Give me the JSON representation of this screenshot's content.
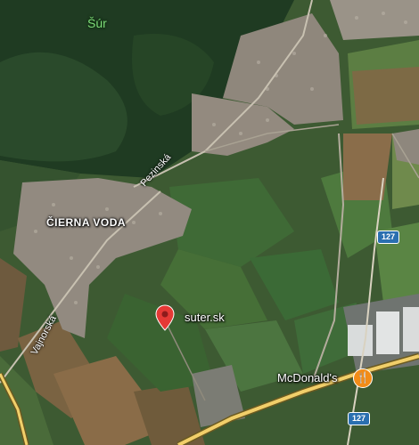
{
  "map": {
    "places": {
      "forest": "Šúr",
      "village": "ČIERNA VODA"
    },
    "roads": {
      "pezinska": "Pezinská",
      "vajnorska": "Vajnorská"
    },
    "shields": {
      "top": "127",
      "bottom": "127"
    },
    "pois": {
      "suter": {
        "label": "suter.sk",
        "icon": "red-map-pin-icon"
      },
      "mcdonalds": {
        "label": "McDonald's",
        "icon": "fork-knife-icon",
        "color": "#f28c18"
      }
    },
    "colors": {
      "pin": "#e53935",
      "highway": "#f1cf6a",
      "shield": "#2a6fb0"
    }
  }
}
